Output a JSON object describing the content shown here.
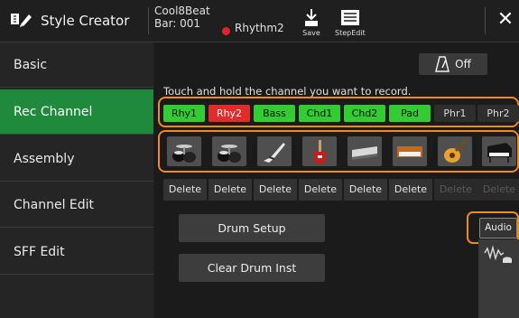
{
  "header": {
    "title": "Style Creator",
    "style_name": "Cool8Beat",
    "bar": "Bar: 001",
    "rec_target": "Rhythm2",
    "save_label": "Save",
    "stepedit_label": "StepEdit"
  },
  "sidebar": {
    "items": [
      {
        "label": "Basic"
      },
      {
        "label": "Rec Channel"
      },
      {
        "label": "Assembly"
      },
      {
        "label": "Channel Edit"
      },
      {
        "label": "SFF Edit"
      }
    ],
    "active": "Rec Channel"
  },
  "main": {
    "metronome_state": "Off",
    "hint": "Touch and hold the channel you want to record.",
    "channels": [
      {
        "label": "Rhy1",
        "state": "on"
      },
      {
        "label": "Rhy2",
        "state": "rec"
      },
      {
        "label": "Bass",
        "state": "on"
      },
      {
        "label": "Chd1",
        "state": "on"
      },
      {
        "label": "Chd2",
        "state": "on"
      },
      {
        "label": "Pad",
        "state": "on"
      },
      {
        "label": "Phr1",
        "state": "off"
      },
      {
        "label": "Phr2",
        "state": "off"
      }
    ],
    "instruments": [
      "drum-kit-icon",
      "drum-kit-icon",
      "bass-guitar-icon",
      "electric-guitar-icon",
      "keyboard-strings-icon",
      "synth-pad-icon",
      "acoustic-guitar-icon",
      "piano-icon"
    ],
    "delete_label": "Delete",
    "delete_enabled": [
      true,
      true,
      true,
      true,
      true,
      true,
      false,
      false
    ],
    "drum_setup_label": "Drum Setup",
    "clear_drum_label": "Clear Drum Inst",
    "audio_label": "Audio"
  },
  "colors": {
    "active_green": "#1f8a3c",
    "channel_on": "#33cc33",
    "channel_rec": "#e22c2c",
    "highlight_orange": "#f08a1a",
    "rec_dot": "#e4222a"
  }
}
